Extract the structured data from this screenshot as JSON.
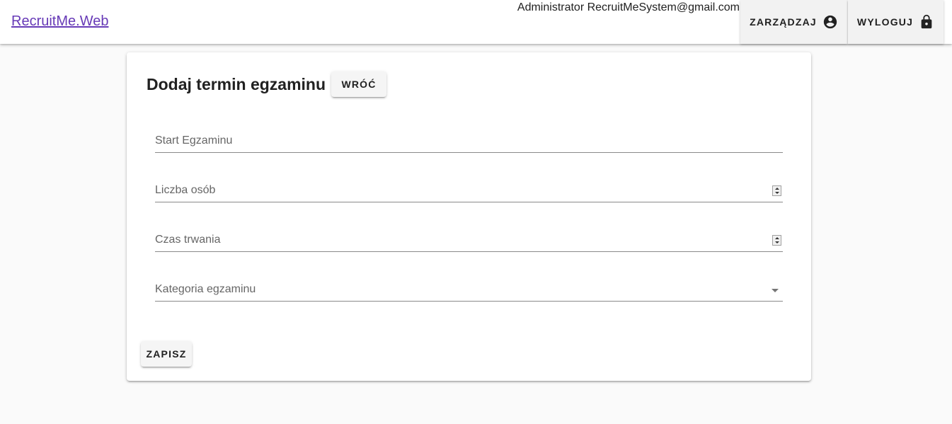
{
  "header": {
    "brand": "RecruitMe.Web",
    "user_email": "Administrator RecruitMeSystem@gmail.com",
    "manage_label": "ZARZĄDZAJ",
    "manage_icon": "account-circle-icon",
    "logout_label": "WYLOGUJ",
    "logout_icon": "lock-icon"
  },
  "form": {
    "title": "Dodaj termin egzaminu",
    "back_label": "WRÓĆ",
    "fields": [
      {
        "label": "Start Egzaminu",
        "type": "text"
      },
      {
        "label": "Liczba osób",
        "type": "number"
      },
      {
        "label": "Czas trwania",
        "type": "number"
      },
      {
        "label": "Kategoria egzaminu",
        "type": "select"
      }
    ],
    "save_label": "ZAPISZ"
  },
  "colors": {
    "brand_link": "#673ab7",
    "background": "#fafafa",
    "surface": "#ffffff"
  }
}
